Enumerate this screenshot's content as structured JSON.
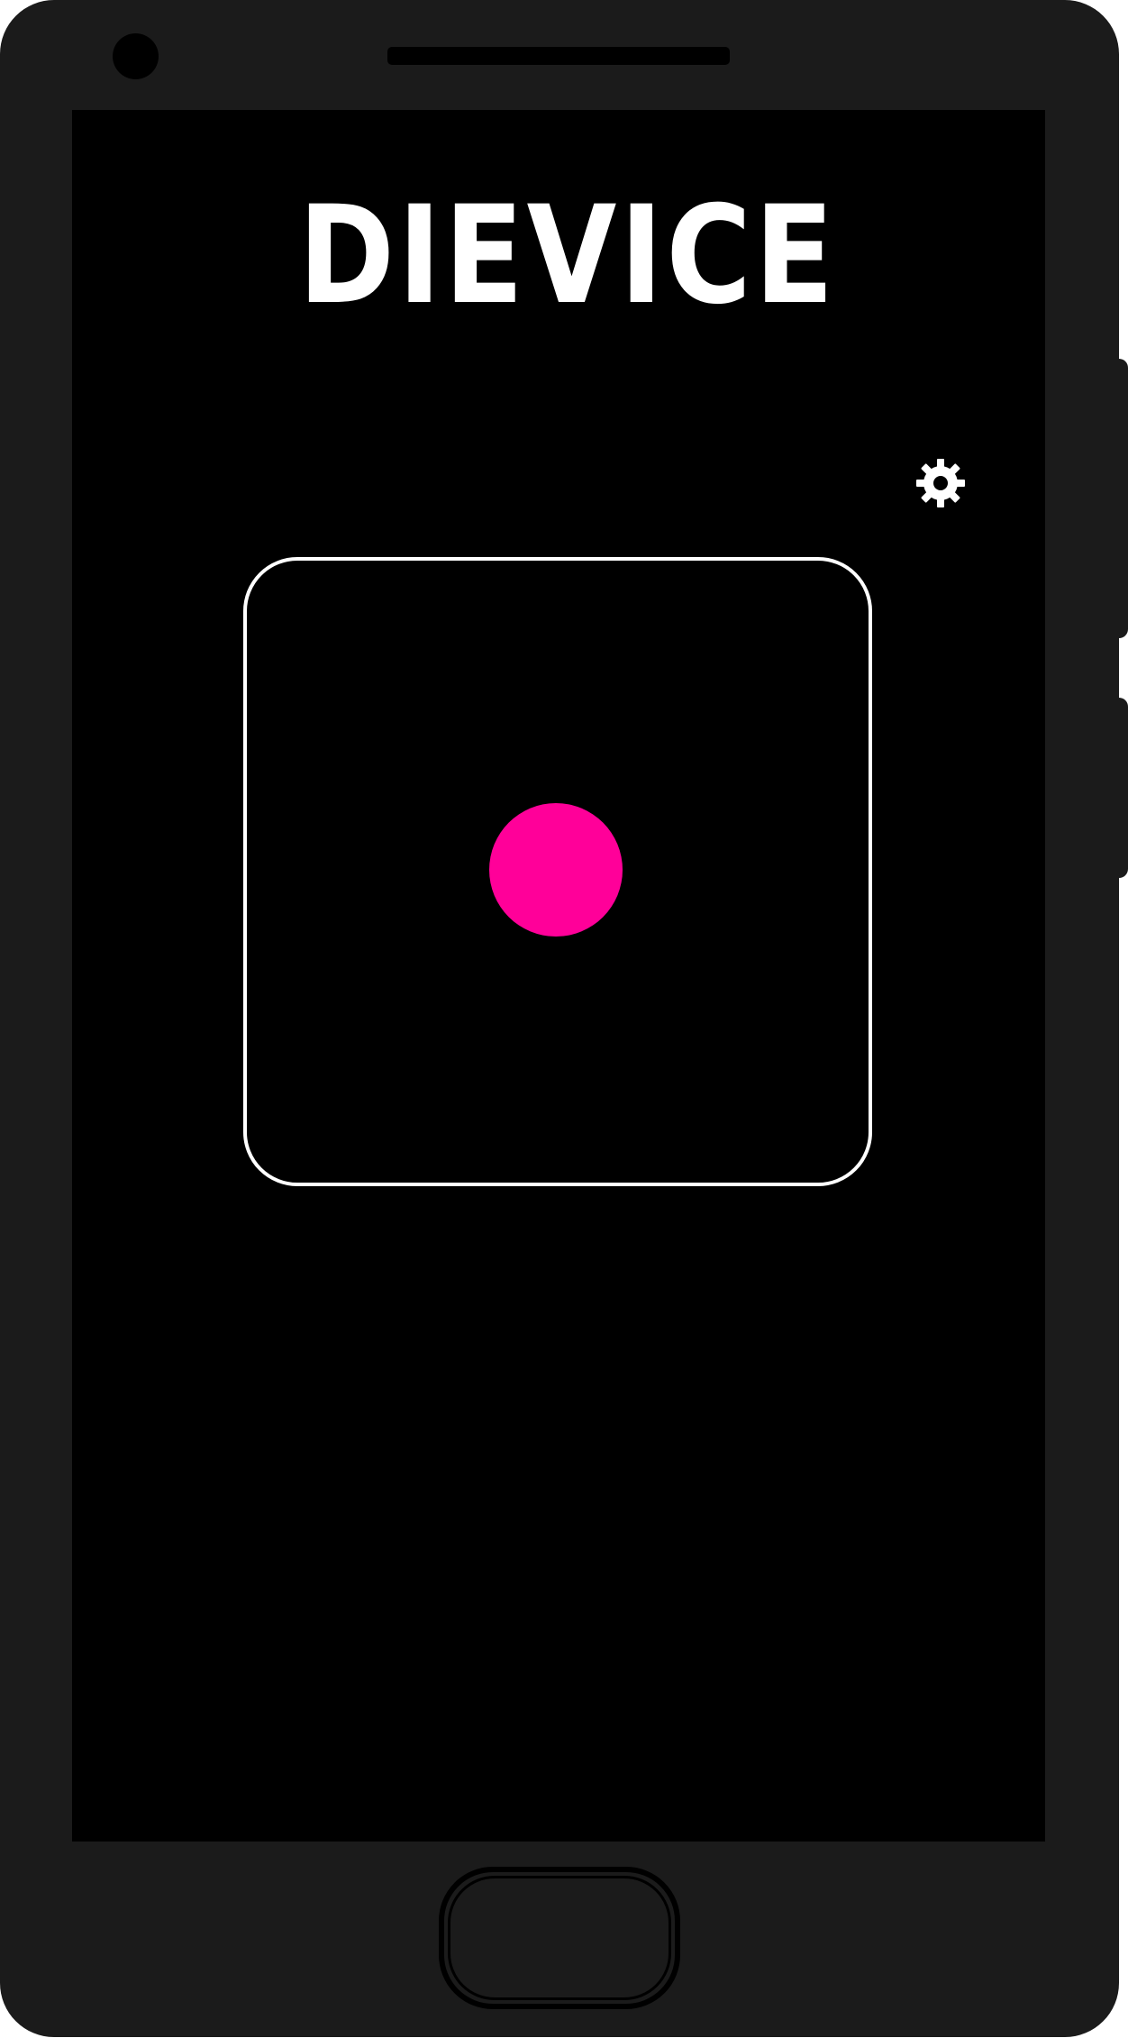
{
  "app": {
    "logo_text": "DIEVICE"
  },
  "icons": {
    "settings": "gear-icon"
  },
  "die": {
    "face_value": 1,
    "dot_color": "#ff0099",
    "border_color": "#ffffff"
  },
  "colors": {
    "device_body": "#1b1b1b",
    "screen": "#000000",
    "text": "#ffffff",
    "accent": "#ff0099"
  }
}
